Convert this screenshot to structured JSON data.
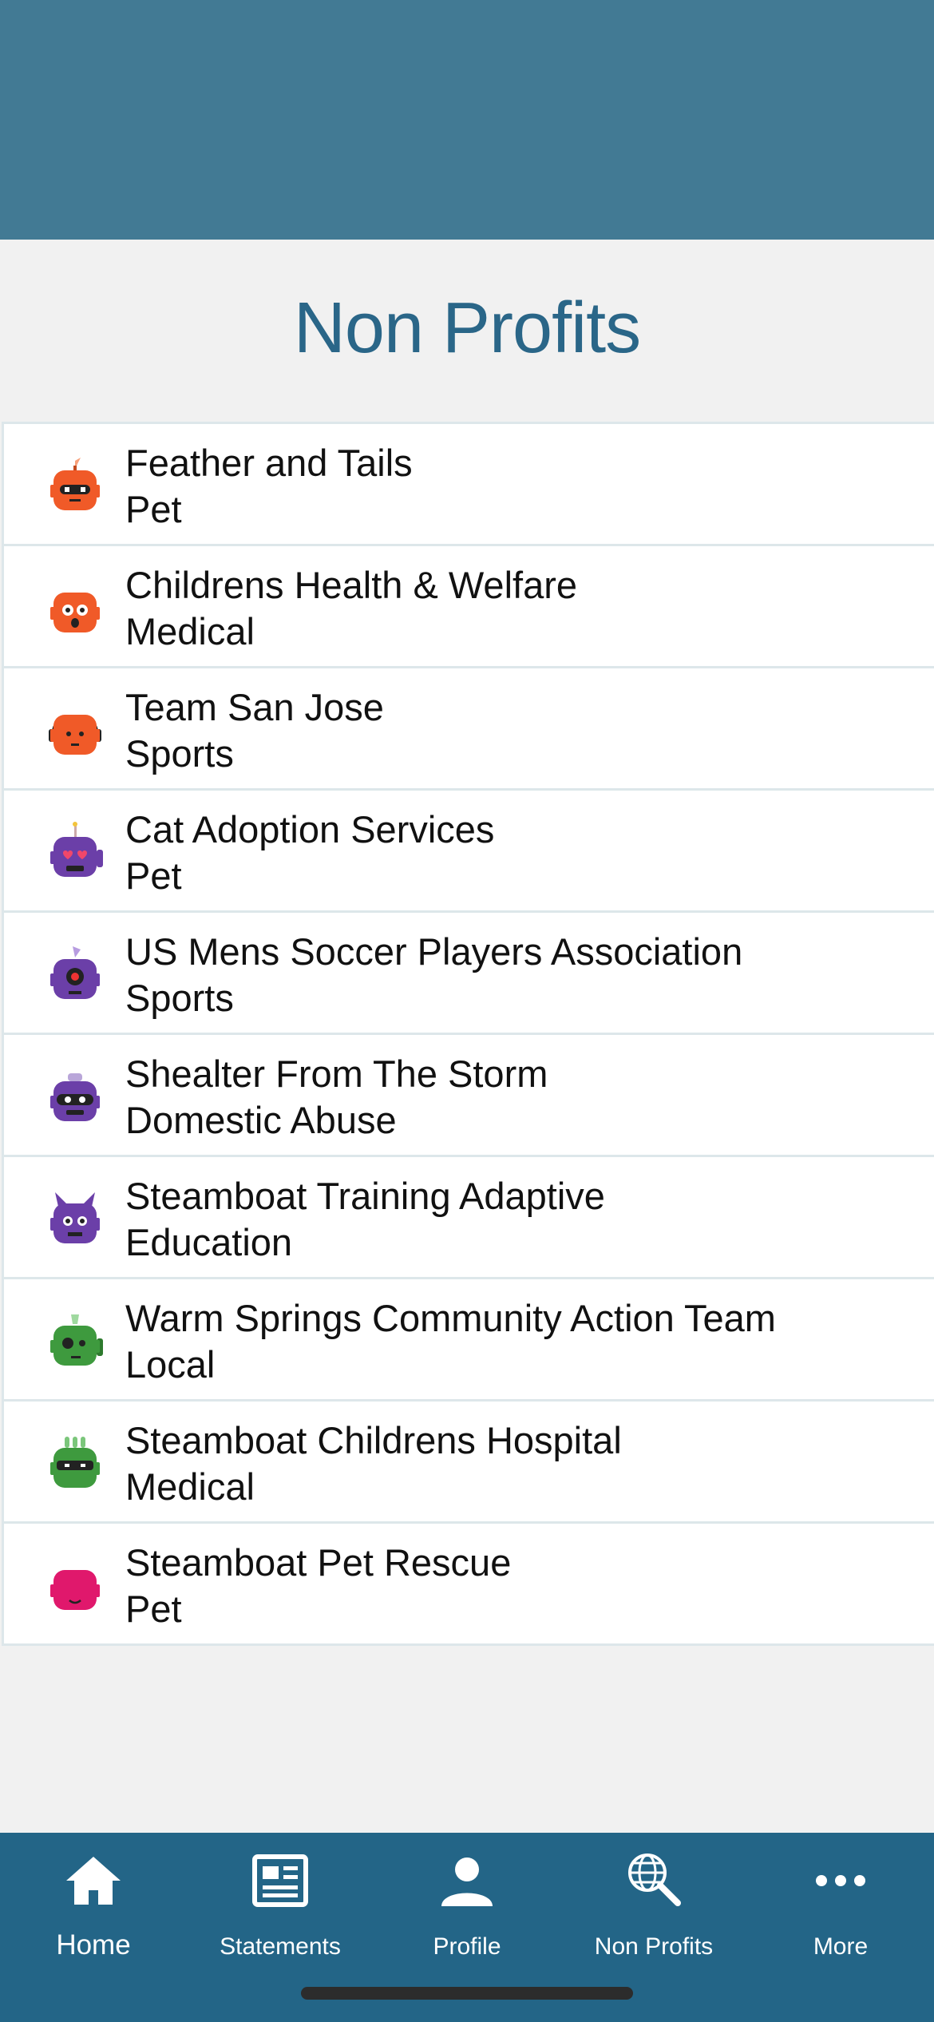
{
  "page": {
    "title": "Non Profits"
  },
  "colors": {
    "header": "#427a94",
    "title": "#2a6688",
    "tabbar": "#236587",
    "background": "#f1f1f1",
    "divider": "#dde7ea"
  },
  "nonprofits": [
    {
      "name": "Feather and Tails",
      "category": "Pet",
      "avatar": "orange-robot-antenna-icon",
      "color": "#f05a28"
    },
    {
      "name": "Childrens Health & Welfare",
      "category": "Medical",
      "avatar": "orange-robot-surprised-icon",
      "color": "#f05a28"
    },
    {
      "name": "Team San Jose",
      "category": "Sports",
      "avatar": "orange-robot-headphones-icon",
      "color": "#f05a28"
    },
    {
      "name": "Cat Adoption Services",
      "category": "Pet",
      "avatar": "purple-robot-heart-eyes-icon",
      "color": "#6b3fa8"
    },
    {
      "name": "US Mens Soccer Players Association",
      "category": "Sports",
      "avatar": "purple-robot-cyclops-icon",
      "color": "#6b3fa8"
    },
    {
      "name": "Shealter From The Storm",
      "category": "Domestic Abuse",
      "avatar": "purple-robot-masked-icon",
      "color": "#6b3fa8"
    },
    {
      "name": "Steamboat Training Adaptive",
      "category": "Education",
      "avatar": "purple-robot-horns-icon",
      "color": "#6b3fa8"
    },
    {
      "name": "Warm Springs Community Action Team",
      "category": "Local",
      "avatar": "green-robot-monocle-icon",
      "color": "#3e9a3e"
    },
    {
      "name": "Steamboat Childrens Hospital",
      "category": "Medical",
      "avatar": "green-robot-camo-icon",
      "color": "#3e9a3e"
    },
    {
      "name": "Steamboat Pet Rescue",
      "category": "Pet",
      "avatar": "pink-robot-sleepy-icon",
      "color": "#e0186c"
    }
  ],
  "tabbar": {
    "tabs": [
      {
        "label": "Home",
        "icon": "home-icon",
        "active": true
      },
      {
        "label": "Statements",
        "icon": "statements-icon",
        "active": false
      },
      {
        "label": "Profile",
        "icon": "profile-icon",
        "active": false
      },
      {
        "label": "Non Profits",
        "icon": "globe-search-icon",
        "active": false
      },
      {
        "label": "More",
        "icon": "more-icon",
        "active": false
      }
    ]
  }
}
